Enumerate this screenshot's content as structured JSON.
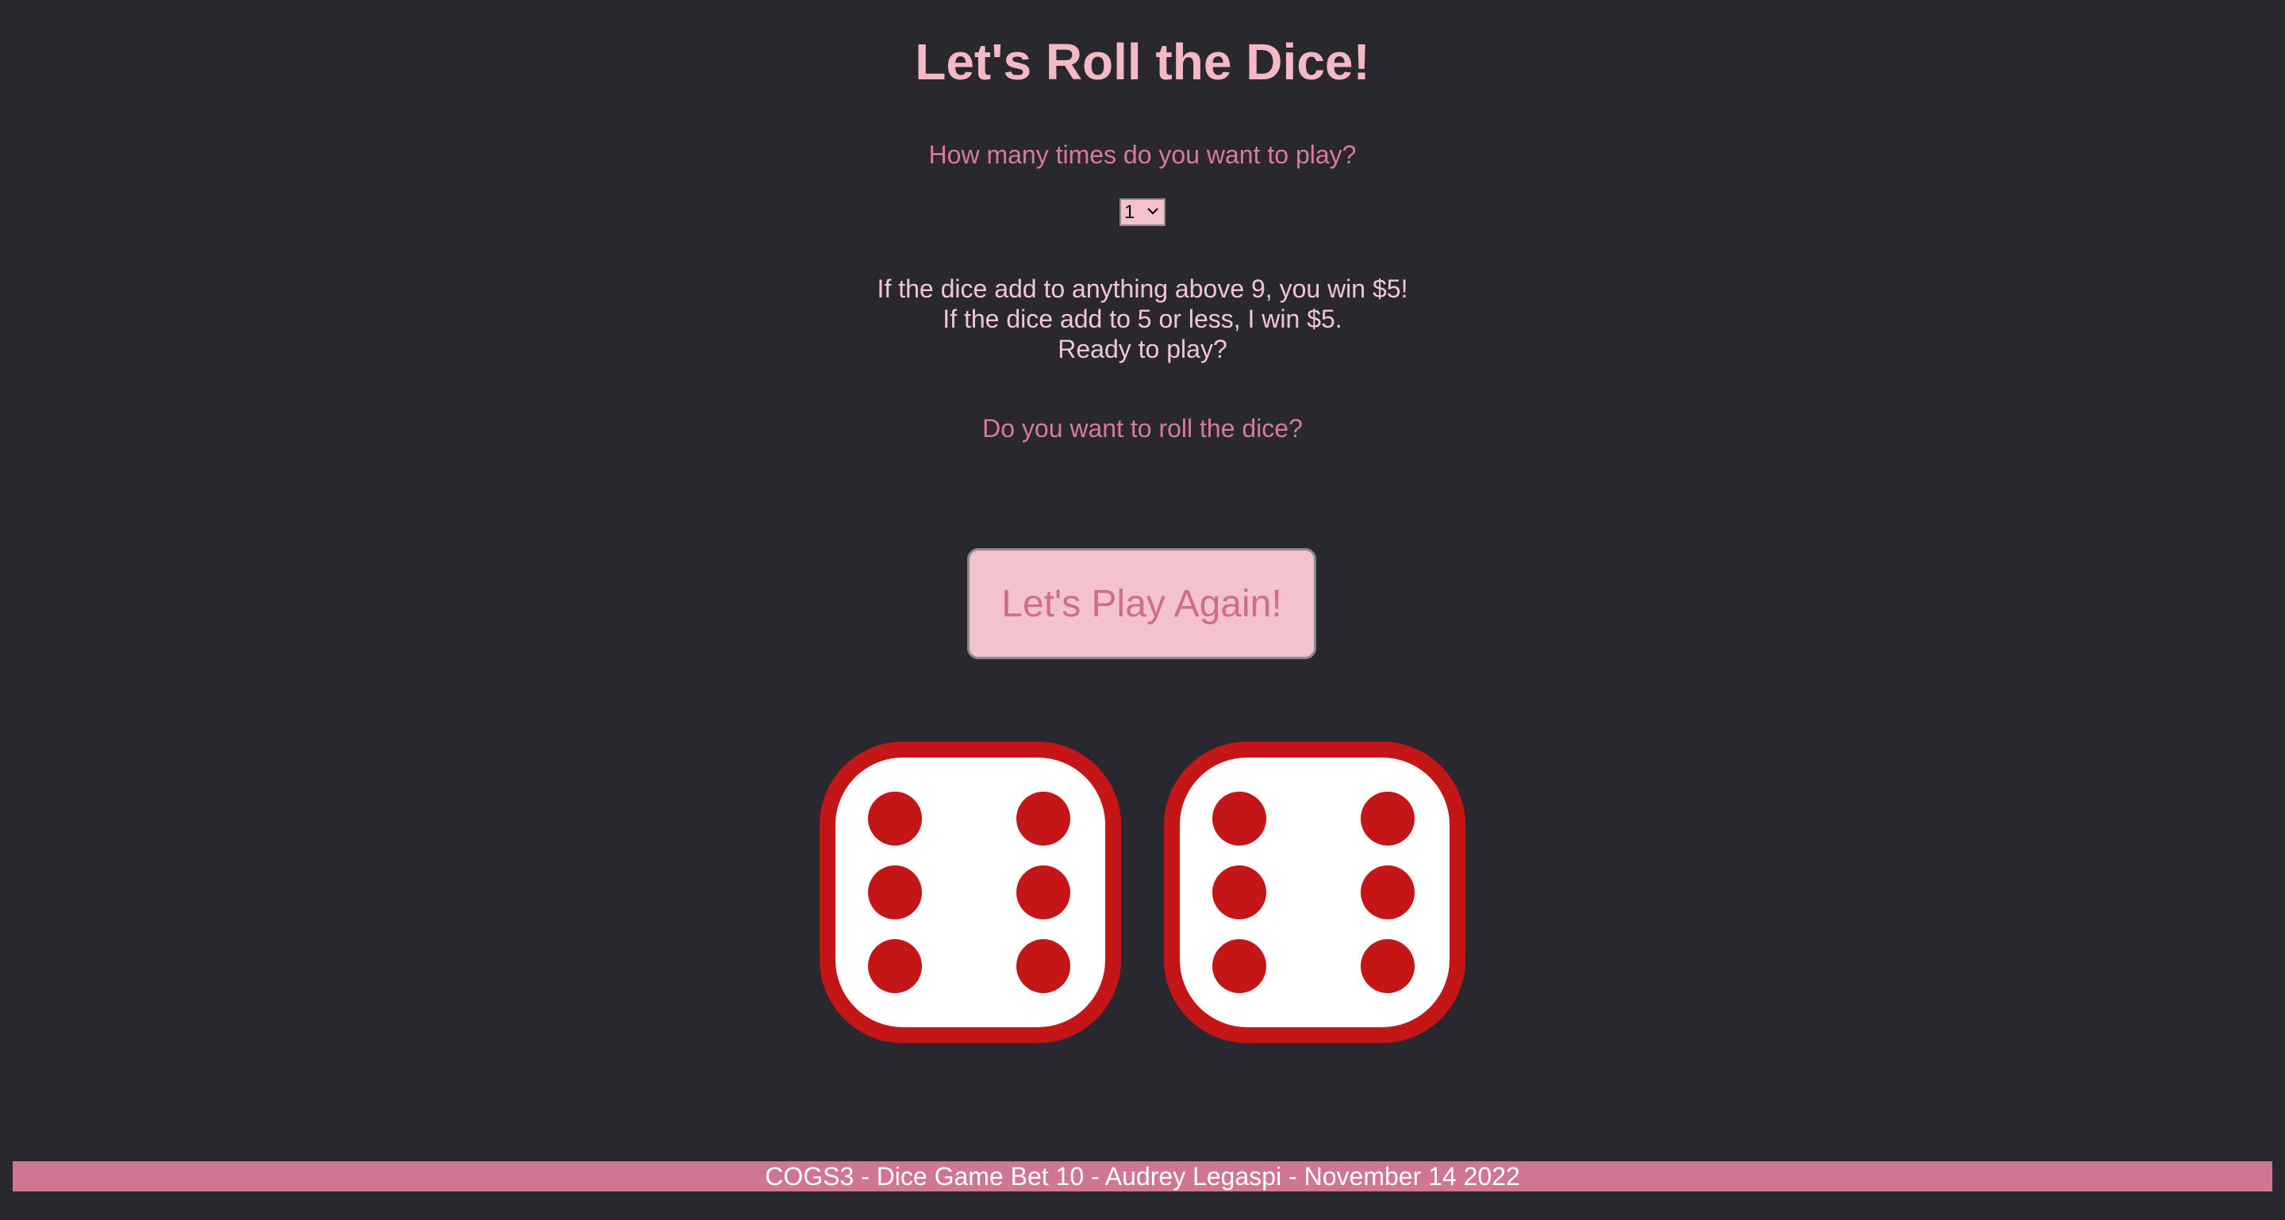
{
  "title": "Let's Roll the Dice!",
  "question_times": "How many times do you want to play?",
  "times_select": {
    "selected": "1",
    "options": [
      "1"
    ]
  },
  "rules": {
    "line1": "If the dice add to anything above 9, you win $5!",
    "line2": "If the dice add to 5 or less, I win $5.",
    "line3": "Ready to play?"
  },
  "question_roll": "Do you want to roll the dice?",
  "play_button_label": "Let's Play Again!",
  "dice": [
    {
      "value": 6
    },
    {
      "value": 6
    }
  ],
  "footer": "COGS3 - Dice Game Bet 10 - Audrey Legaspi - November 14 2022",
  "colors": {
    "background": "#28282e",
    "title": "#f4b8c6",
    "accent": "#cf7792",
    "die_border": "#c41616",
    "die_face": "#ffffff"
  },
  "icons": {
    "die": "dice-six-icon",
    "select_chevron": "chevron-down-icon"
  }
}
